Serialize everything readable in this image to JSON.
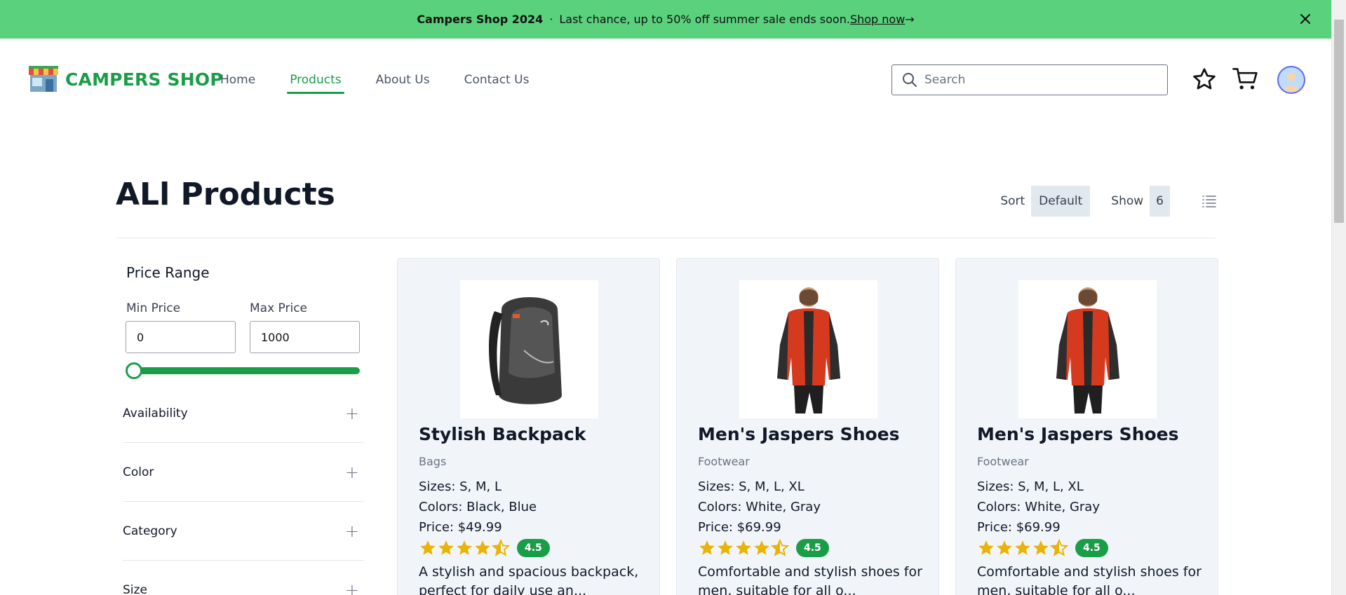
{
  "banner": {
    "brand": "Campers Shop 2024",
    "separator": "·",
    "message": "Last chance, up to 50% off summer sale ends soon.",
    "link": " Shop now",
    "arrow": "→"
  },
  "brand": {
    "name": "CAMPERS SHOP"
  },
  "nav": {
    "items": [
      {
        "label": "Home",
        "active": false
      },
      {
        "label": "Products",
        "active": true
      },
      {
        "label": "About Us",
        "active": false
      },
      {
        "label": "Contact Us",
        "active": false
      }
    ]
  },
  "search": {
    "placeholder": "Search",
    "value": ""
  },
  "header_icons": [
    "star-icon",
    "cart-icon",
    "avatar"
  ],
  "page": {
    "title": "ALl Products"
  },
  "controls": {
    "sort_label": "Sort",
    "sort_value": "Default",
    "show_label": "Show",
    "show_value": "6"
  },
  "filters": {
    "price_range": {
      "title": "Price Range",
      "min_label": "Min Price",
      "max_label": "Max Price",
      "min_value": "0",
      "max_value": "1000"
    },
    "accordions": [
      {
        "label": "Availability",
        "icon": "+"
      },
      {
        "label": "Color",
        "icon": "+"
      },
      {
        "label": "Category",
        "icon": "+"
      },
      {
        "label": "Size",
        "icon": "+"
      }
    ]
  },
  "products": [
    {
      "name": "Stylish Backpack",
      "category": "Bags",
      "sizes": "Sizes: S, M, L",
      "colors": "Colors: Black, Blue",
      "price": "Price: $49.99",
      "rating": "4.5",
      "description": "A stylish and spacious backpack, perfect for daily use an...",
      "image": "backpack"
    },
    {
      "name": "Men's Jaspers Shoes",
      "category": "Footwear",
      "sizes": "Sizes: S, M, L, XL",
      "colors": "Colors: White, Gray",
      "price": "Price: $69.99",
      "rating": "4.5",
      "description": "Comfortable and stylish shoes for men, suitable for all o...",
      "image": "jacket"
    },
    {
      "name": "Men's Jaspers Shoes",
      "category": "Footwear",
      "sizes": "Sizes: S, M, L, XL",
      "colors": "Colors: White, Gray",
      "price": "Price: $69.99",
      "rating": "4.5",
      "description": "Comfortable and stylish shoes for men, suitable for all o...",
      "image": "jacket"
    }
  ],
  "colors": {
    "banner": "#5ad17c",
    "brand_green": "#1a9d47",
    "star": "#eab308",
    "card_bg": "#f1f5f9"
  }
}
